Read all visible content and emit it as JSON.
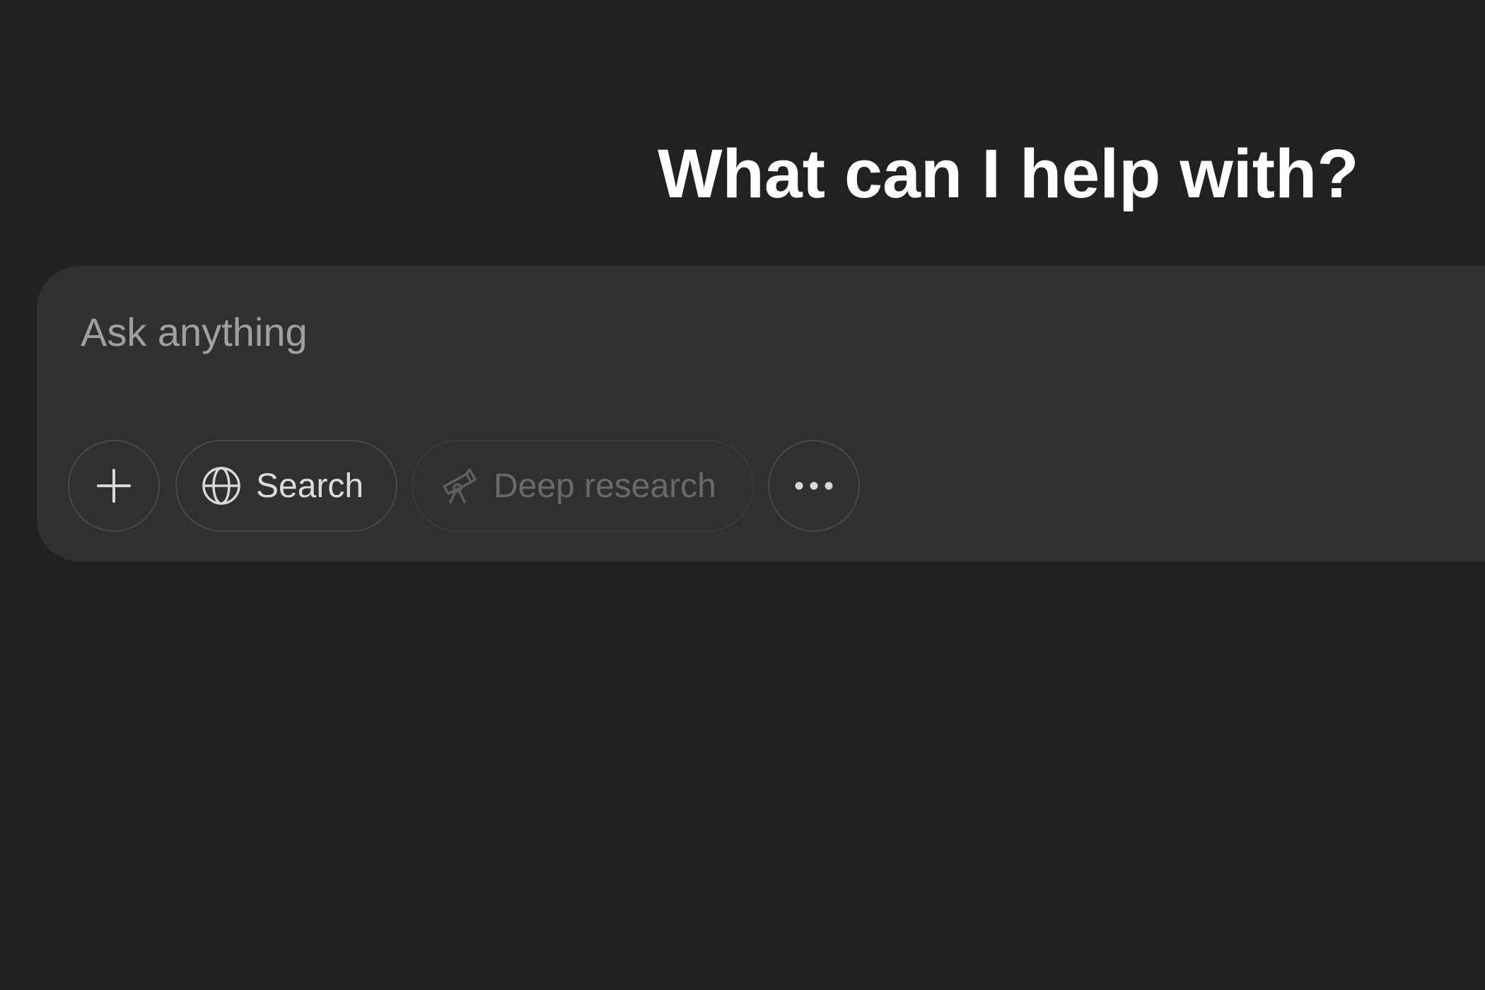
{
  "main": {
    "heading": "What can I help with?"
  },
  "composer": {
    "placeholder": "Ask anything",
    "tools": {
      "add_icon": "plus-icon",
      "search": {
        "label": "Search",
        "icon": "globe-icon"
      },
      "deep_research": {
        "label": "Deep research",
        "icon": "telescope-icon",
        "state": "disabled"
      },
      "more_icon": "more-dots-icon"
    }
  },
  "colors": {
    "background": "#212121",
    "composer": "#303030",
    "text": "#ffffff",
    "placeholder": "#a0a0a0",
    "muted": "#6a6a6a"
  }
}
